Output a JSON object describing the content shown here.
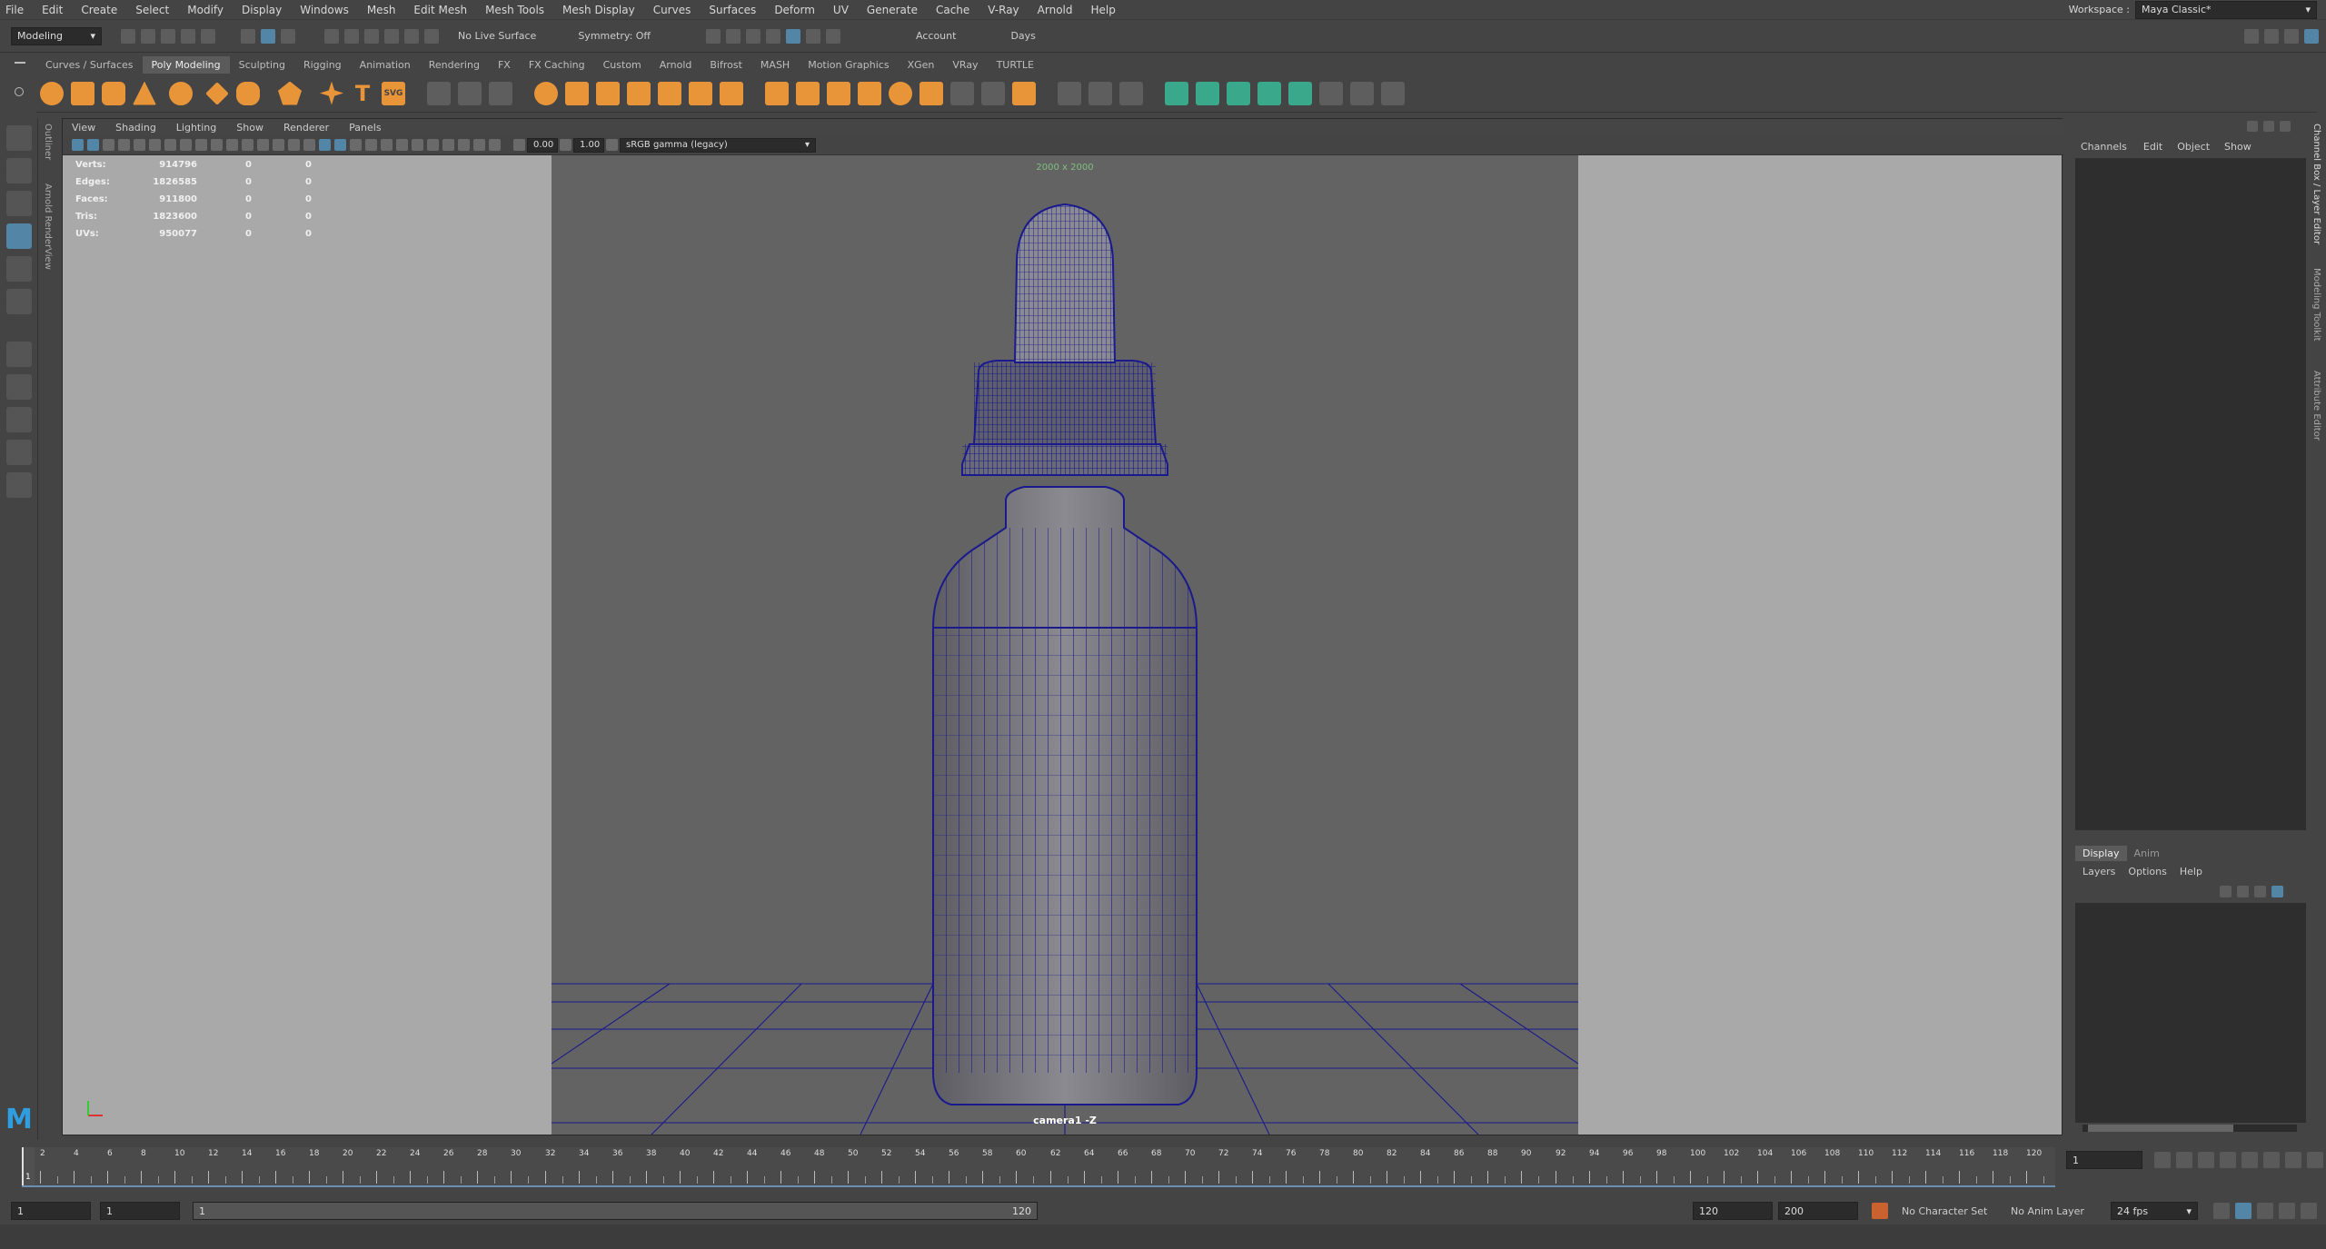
{
  "menubar": {
    "items": [
      "File",
      "Edit",
      "Create",
      "Select",
      "Modify",
      "Display",
      "Windows",
      "Mesh",
      "Edit Mesh",
      "Mesh Tools",
      "Mesh Display",
      "Curves",
      "Surfaces",
      "Deform",
      "UV",
      "Generate",
      "Cache",
      "V-Ray",
      "Arnold",
      "Help"
    ],
    "workspace_label": "Workspace :",
    "workspace_value": "Maya Classic*"
  },
  "statusline": {
    "mode": "Modeling",
    "live_surface": "No Live Surface",
    "symmetry": "Symmetry: Off",
    "account": "Account",
    "days": "Days"
  },
  "shelf": {
    "tabs": [
      "Curves / Surfaces",
      "Poly Modeling",
      "Sculpting",
      "Rigging",
      "Animation",
      "Rendering",
      "FX",
      "FX Caching",
      "Custom",
      "Arnold",
      "Bifrost",
      "MASH",
      "Motion Graphics",
      "XGen",
      "VRay",
      "TURTLE"
    ],
    "active_tab": "Poly Modeling"
  },
  "viewport": {
    "menus": [
      "View",
      "Shading",
      "Lighting",
      "Show",
      "Renderer",
      "Panels"
    ],
    "exposure": "0.00",
    "gamma": "1.00",
    "color_space": "sRGB gamma (legacy)",
    "resolution_gate": "2000 x 2000",
    "camera": "camera1 -Z",
    "hud": [
      {
        "label": "Verts:",
        "v1": "914796",
        "v2": "0",
        "v3": "0"
      },
      {
        "label": "Edges:",
        "v1": "1826585",
        "v2": "0",
        "v3": "0"
      },
      {
        "label": "Faces:",
        "v1": "911800",
        "v2": "0",
        "v3": "0"
      },
      {
        "label": "Tris:",
        "v1": "1823600",
        "v2": "0",
        "v3": "0"
      },
      {
        "label": "UVs:",
        "v1": "950077",
        "v2": "0",
        "v3": "0"
      }
    ]
  },
  "left_vertical_tabs": [
    "Outliner",
    "Arnold RenderView"
  ],
  "right_vertical_tabs": [
    "Channel Box / Layer Editor",
    "Modeling Toolkit",
    "Attribute Editor"
  ],
  "channel_box": {
    "menus": [
      "Channels",
      "Edit",
      "Object",
      "Show"
    ]
  },
  "layer_editor": {
    "tabs": [
      "Display",
      "Anim"
    ],
    "active_tab": "Display",
    "menus": [
      "Layers",
      "Options",
      "Help"
    ]
  },
  "timeline": {
    "ticks": [
      "2",
      "4",
      "6",
      "8",
      "10",
      "12",
      "14",
      "16",
      "18",
      "20",
      "22",
      "24",
      "26",
      "28",
      "30",
      "32",
      "34",
      "36",
      "38",
      "40",
      "42",
      "44",
      "46",
      "48",
      "50",
      "52",
      "54",
      "56",
      "58",
      "60",
      "62",
      "64",
      "66",
      "68",
      "70",
      "72",
      "74",
      "76",
      "78",
      "80",
      "82",
      "84",
      "86",
      "88",
      "90",
      "92",
      "94",
      "96",
      "98",
      "100",
      "102",
      "104",
      "106",
      "108",
      "110",
      "112",
      "114",
      "116",
      "118",
      "120"
    ],
    "current_marker": "1",
    "current_frame": "1"
  },
  "range": {
    "start": "1",
    "playback_start": "1",
    "slider_start": "1",
    "slider_end": "120",
    "playback_end": "120",
    "end": "200",
    "character_set": "No Character Set",
    "anim_layer": "No Anim Layer",
    "fps": "24 fps"
  },
  "colors": {
    "wireframe": "#1a1a8c",
    "selection_blue": "#5285a6",
    "shelf_orange": "#e8953a",
    "shelf_green": "#3aa88a"
  }
}
